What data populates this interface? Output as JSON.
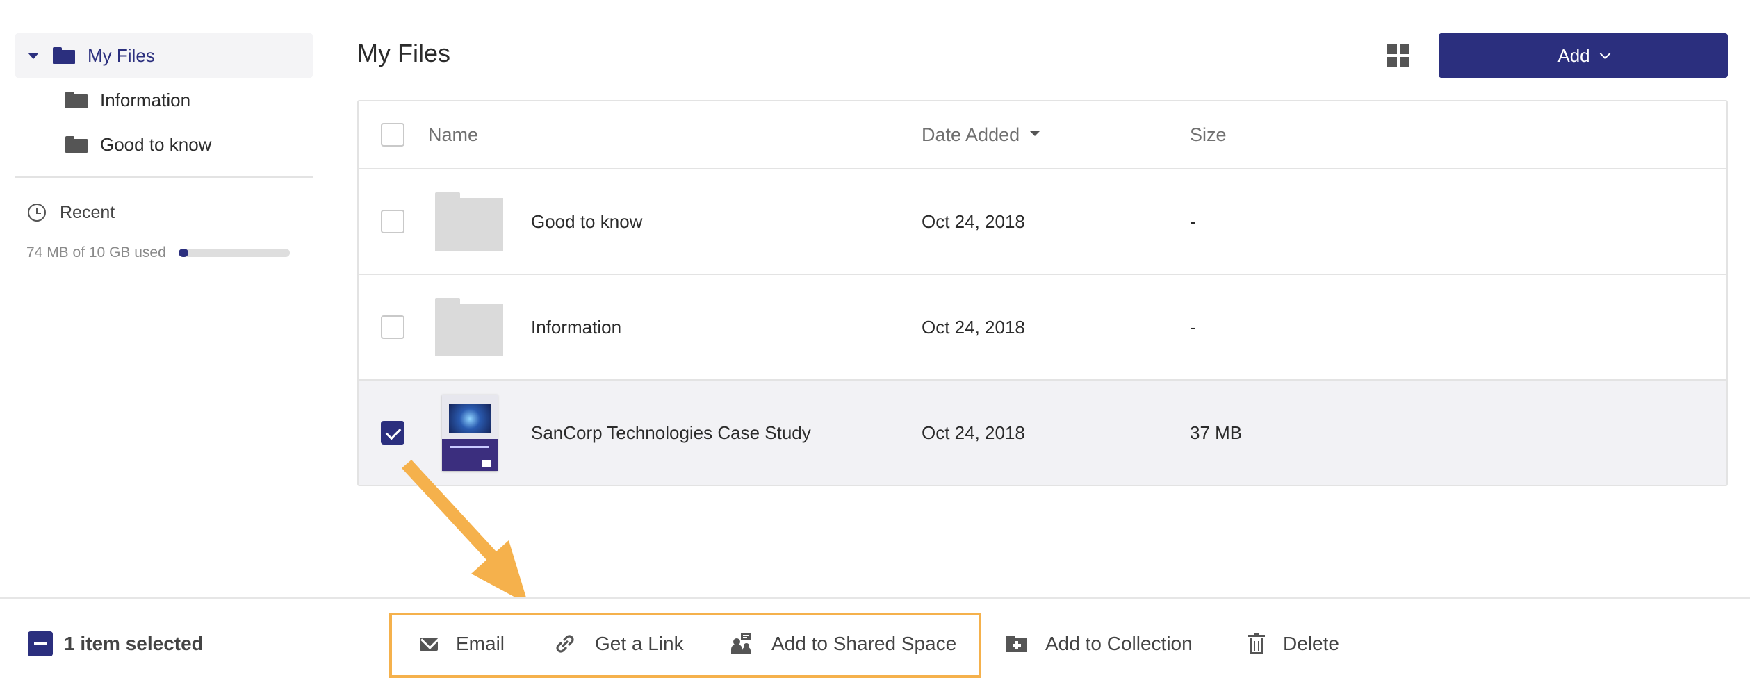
{
  "sidebar": {
    "root_label": "My Files",
    "children": [
      "Information",
      "Good to know"
    ],
    "recent_label": "Recent",
    "storage_text": "74 MB of 10 GB used",
    "storage_used_fraction": 0.0074
  },
  "header": {
    "title": "My Files",
    "add_label": "Add"
  },
  "table": {
    "columns": {
      "name": "Name",
      "date": "Date Added",
      "size": "Size"
    },
    "rows": [
      {
        "name": "Good to know",
        "date": "Oct 24, 2018",
        "size": "-",
        "type": "folder",
        "selected": false
      },
      {
        "name": "Information",
        "date": "Oct 24, 2018",
        "size": "-",
        "type": "folder",
        "selected": false
      },
      {
        "name": "SanCorp Technologies Case Study",
        "date": "Oct 24, 2018",
        "size": "37 MB",
        "type": "document",
        "selected": true
      }
    ]
  },
  "action_bar": {
    "selection_text": "1 item selected",
    "actions": {
      "email": "Email",
      "get_link": "Get a Link",
      "shared_space": "Add to Shared Space",
      "collection": "Add to Collection",
      "delete": "Delete"
    }
  },
  "colors": {
    "brand": "#2b2f7e",
    "highlight": "#f5b14c",
    "selected_row": "#f2f2f5"
  }
}
